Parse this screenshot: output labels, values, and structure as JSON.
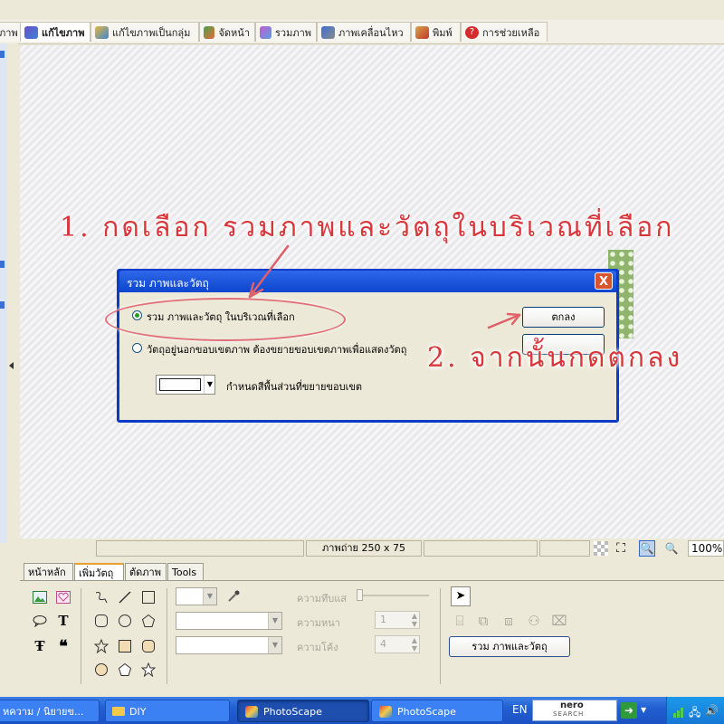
{
  "top_tabs": [
    {
      "label": "ภาพ",
      "icon": "app-icon"
    },
    {
      "label": "แก้ไขภาพ",
      "icon": "edit-photo-icon"
    },
    {
      "label": "แก้ไขภาพเป็นกลุ่ม",
      "icon": "batch-edit-icon"
    },
    {
      "label": "จัดหน้า",
      "icon": "page-layout-icon"
    },
    {
      "label": "รวมภาพ",
      "icon": "combine-icon"
    },
    {
      "label": "ภาพเคลื่อนไหว",
      "icon": "animation-icon"
    },
    {
      "label": "พิมพ์",
      "icon": "print-icon"
    },
    {
      "label": "การช่วยเหลือ",
      "icon": "help-icon"
    }
  ],
  "dialog": {
    "title": "รวม ภาพและวัตถุ",
    "close_label": "X",
    "option1": "รวม ภาพและวัตถุ ในบริเวณที่เลือก",
    "option2": "วัตถุอยู่นอกขอบเขตภาพ ต้องขยายขอบเขตภาพเพื่อแสดงวัตถุ",
    "fill_label": "กำหนดสีพื้นส่วนที่ขยายขอบเขต",
    "ok_label": "ตกลง"
  },
  "annotations": {
    "step1": "1. กดเลือก รวมภาพและวัตถุในบริเวณที่เลือก",
    "step2": "2. จากนั้นกดตกลง"
  },
  "status": {
    "image_size": "ภาพถ่าย 250 x 75",
    "zoom": "100%"
  },
  "bottom_tabs": [
    "หน้าหลัก",
    "เพิ่มวัตถุ",
    "ตัดภาพ",
    "Tools"
  ],
  "bottom_props": {
    "opacity_label": "ความทึบแส",
    "thickness_label": "ความหนา",
    "thickness_value": "1",
    "roundness_label": "ความโค้ง",
    "roundness_value": "4",
    "merge_button": "รวม ภาพและวัตถุ"
  },
  "taskbar": {
    "items": [
      "หความ / นิยายข...",
      "DIY",
      "PhotoScape",
      "PhotoScape"
    ],
    "lang": "EN",
    "nero_top": "nero",
    "nero_bottom": "SEARCH"
  },
  "colors": {
    "dialog_title": "#0d46d0",
    "annotation_red": "#d8363a",
    "taskbar_blue": "#225fd1",
    "canvas_image_green": "#8fb46b"
  }
}
